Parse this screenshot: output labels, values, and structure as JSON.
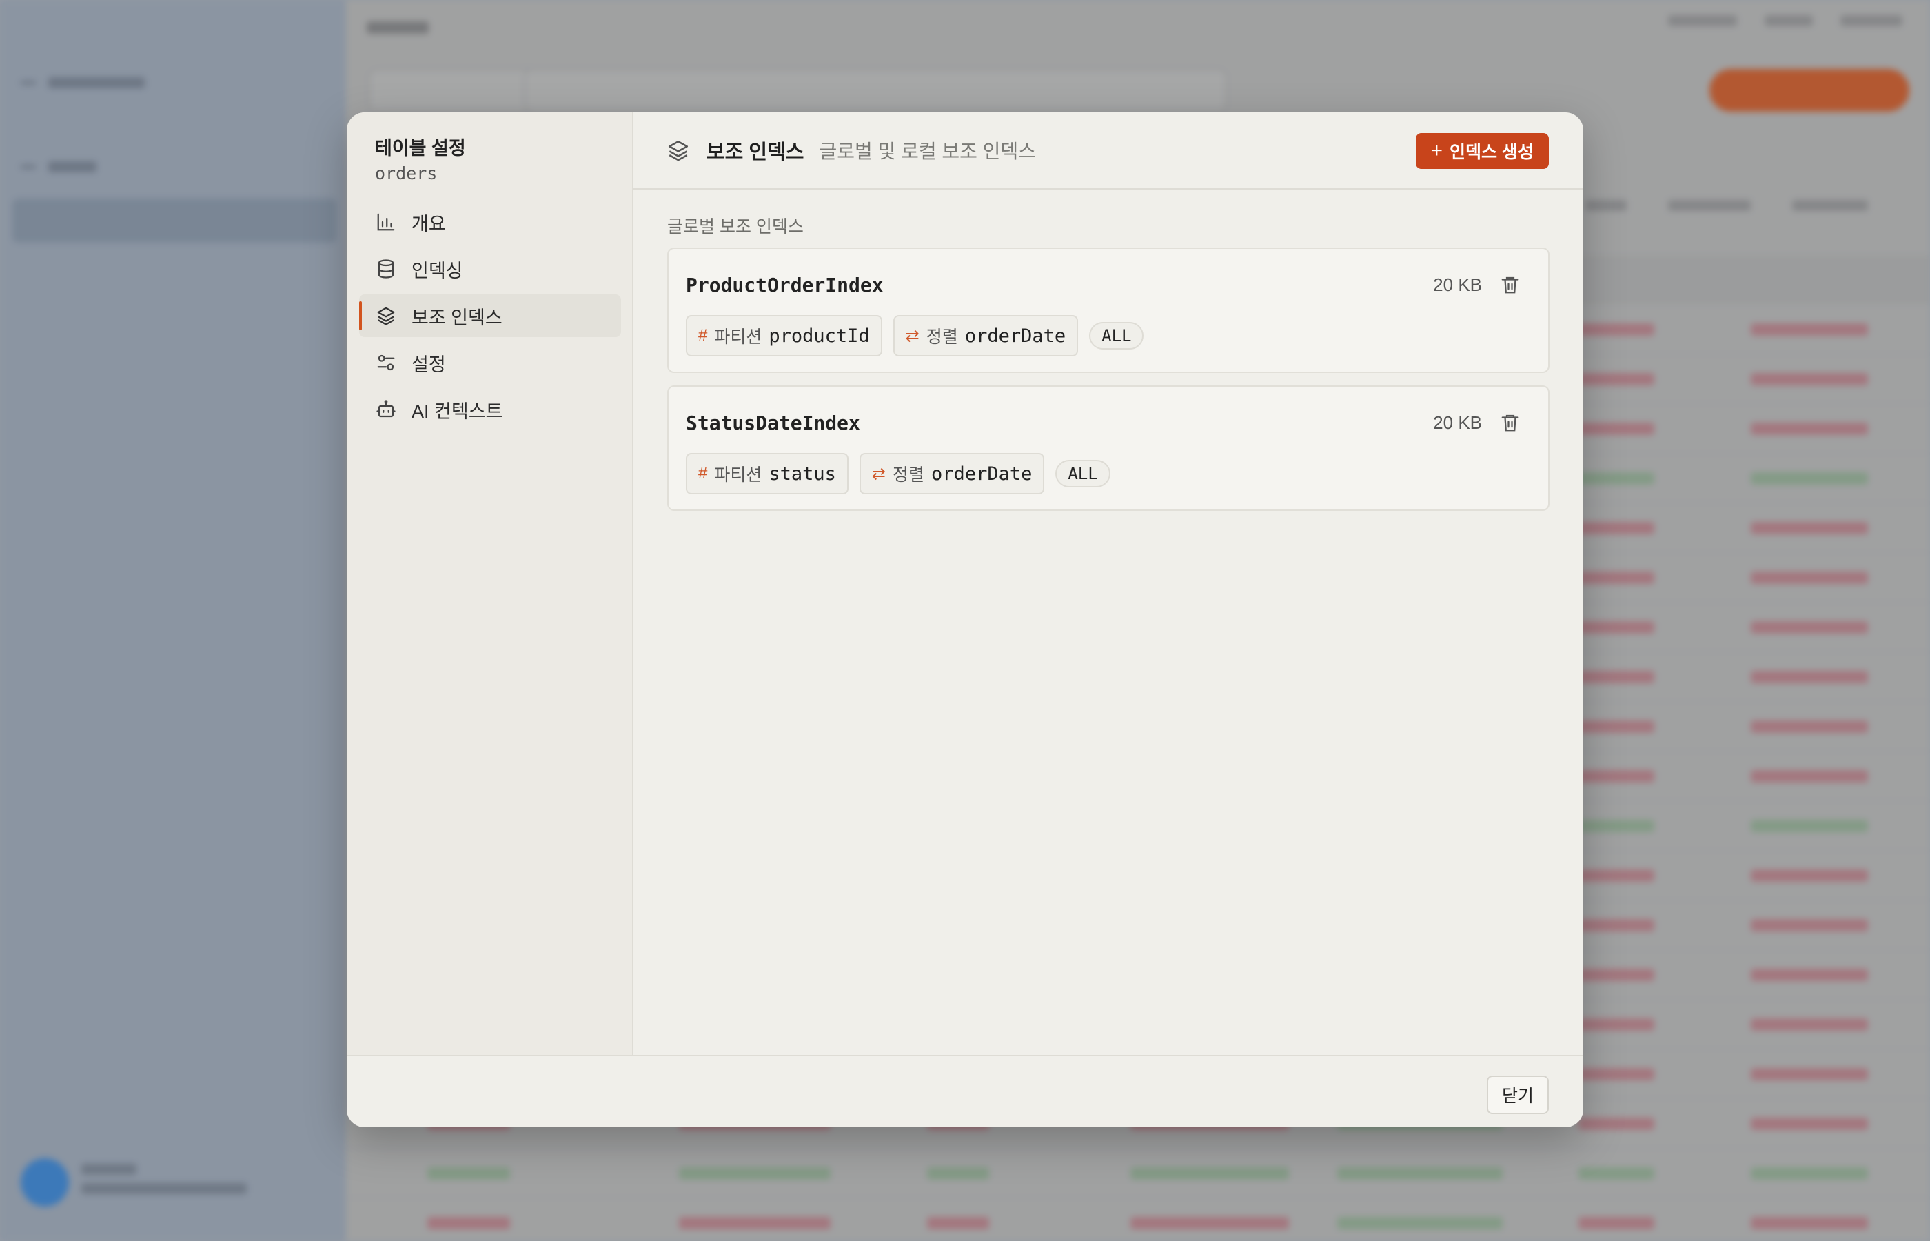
{
  "modal": {
    "title": "테이블 설정",
    "table_name": "orders",
    "nav": [
      {
        "label": "개요",
        "icon": "bar-chart-icon",
        "active": false
      },
      {
        "label": "인덱싱",
        "icon": "database-icon",
        "active": false
      },
      {
        "label": "보조 인덱스",
        "icon": "layers-icon",
        "active": true
      },
      {
        "label": "설정",
        "icon": "sliders-icon",
        "active": false
      },
      {
        "label": "AI 컨텍스트",
        "icon": "bot-icon",
        "active": false
      }
    ],
    "header": {
      "title": "보조 인덱스",
      "description": "글로벌 및 로컬 보조 인덱스",
      "create_button": "인덱스 생성",
      "create_icon": "+"
    },
    "section_label": "글로벌 보조 인덱스",
    "indexes": [
      {
        "name": "ProductOrderIndex",
        "size": "20 KB",
        "partition_label": "파티션",
        "partition_key": "productId",
        "sort_label": "정렬",
        "sort_key": "orderDate",
        "projection": "ALL"
      },
      {
        "name": "StatusDateIndex",
        "size": "20 KB",
        "partition_label": "파티션",
        "partition_key": "status",
        "sort_label": "정렬",
        "sort_key": "orderDate",
        "projection": "ALL"
      }
    ],
    "footer": {
      "close_button": "닫기"
    }
  },
  "colors": {
    "accent": "#c8441b",
    "chip_icon": "#d0582a"
  }
}
